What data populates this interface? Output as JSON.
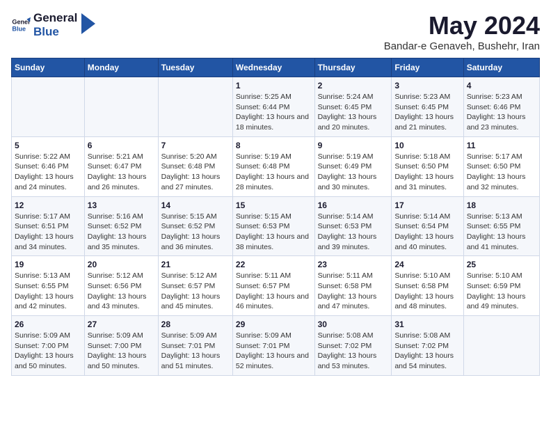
{
  "logo": {
    "text_general": "General",
    "text_blue": "Blue"
  },
  "title": "May 2024",
  "subtitle": "Bandar-e Genaveh, Bushehr, Iran",
  "days_of_week": [
    "Sunday",
    "Monday",
    "Tuesday",
    "Wednesday",
    "Thursday",
    "Friday",
    "Saturday"
  ],
  "weeks": [
    [
      {
        "day": "",
        "info": ""
      },
      {
        "day": "",
        "info": ""
      },
      {
        "day": "",
        "info": ""
      },
      {
        "day": "1",
        "sunrise": "5:25 AM",
        "sunset": "6:44 PM",
        "daylight": "13 hours and 18 minutes."
      },
      {
        "day": "2",
        "sunrise": "5:24 AM",
        "sunset": "6:45 PM",
        "daylight": "13 hours and 20 minutes."
      },
      {
        "day": "3",
        "sunrise": "5:23 AM",
        "sunset": "6:45 PM",
        "daylight": "13 hours and 21 minutes."
      },
      {
        "day": "4",
        "sunrise": "5:23 AM",
        "sunset": "6:46 PM",
        "daylight": "13 hours and 23 minutes."
      }
    ],
    [
      {
        "day": "5",
        "sunrise": "5:22 AM",
        "sunset": "6:46 PM",
        "daylight": "13 hours and 24 minutes."
      },
      {
        "day": "6",
        "sunrise": "5:21 AM",
        "sunset": "6:47 PM",
        "daylight": "13 hours and 26 minutes."
      },
      {
        "day": "7",
        "sunrise": "5:20 AM",
        "sunset": "6:48 PM",
        "daylight": "13 hours and 27 minutes."
      },
      {
        "day": "8",
        "sunrise": "5:19 AM",
        "sunset": "6:48 PM",
        "daylight": "13 hours and 28 minutes."
      },
      {
        "day": "9",
        "sunrise": "5:19 AM",
        "sunset": "6:49 PM",
        "daylight": "13 hours and 30 minutes."
      },
      {
        "day": "10",
        "sunrise": "5:18 AM",
        "sunset": "6:50 PM",
        "daylight": "13 hours and 31 minutes."
      },
      {
        "day": "11",
        "sunrise": "5:17 AM",
        "sunset": "6:50 PM",
        "daylight": "13 hours and 32 minutes."
      }
    ],
    [
      {
        "day": "12",
        "sunrise": "5:17 AM",
        "sunset": "6:51 PM",
        "daylight": "13 hours and 34 minutes."
      },
      {
        "day": "13",
        "sunrise": "5:16 AM",
        "sunset": "6:52 PM",
        "daylight": "13 hours and 35 minutes."
      },
      {
        "day": "14",
        "sunrise": "5:15 AM",
        "sunset": "6:52 PM",
        "daylight": "13 hours and 36 minutes."
      },
      {
        "day": "15",
        "sunrise": "5:15 AM",
        "sunset": "6:53 PM",
        "daylight": "13 hours and 38 minutes."
      },
      {
        "day": "16",
        "sunrise": "5:14 AM",
        "sunset": "6:53 PM",
        "daylight": "13 hours and 39 minutes."
      },
      {
        "day": "17",
        "sunrise": "5:14 AM",
        "sunset": "6:54 PM",
        "daylight": "13 hours and 40 minutes."
      },
      {
        "day": "18",
        "sunrise": "5:13 AM",
        "sunset": "6:55 PM",
        "daylight": "13 hours and 41 minutes."
      }
    ],
    [
      {
        "day": "19",
        "sunrise": "5:13 AM",
        "sunset": "6:55 PM",
        "daylight": "13 hours and 42 minutes."
      },
      {
        "day": "20",
        "sunrise": "5:12 AM",
        "sunset": "6:56 PM",
        "daylight": "13 hours and 43 minutes."
      },
      {
        "day": "21",
        "sunrise": "5:12 AM",
        "sunset": "6:57 PM",
        "daylight": "13 hours and 45 minutes."
      },
      {
        "day": "22",
        "sunrise": "5:11 AM",
        "sunset": "6:57 PM",
        "daylight": "13 hours and 46 minutes."
      },
      {
        "day": "23",
        "sunrise": "5:11 AM",
        "sunset": "6:58 PM",
        "daylight": "13 hours and 47 minutes."
      },
      {
        "day": "24",
        "sunrise": "5:10 AM",
        "sunset": "6:58 PM",
        "daylight": "13 hours and 48 minutes."
      },
      {
        "day": "25",
        "sunrise": "5:10 AM",
        "sunset": "6:59 PM",
        "daylight": "13 hours and 49 minutes."
      }
    ],
    [
      {
        "day": "26",
        "sunrise": "5:09 AM",
        "sunset": "7:00 PM",
        "daylight": "13 hours and 50 minutes."
      },
      {
        "day": "27",
        "sunrise": "5:09 AM",
        "sunset": "7:00 PM",
        "daylight": "13 hours and 50 minutes."
      },
      {
        "day": "28",
        "sunrise": "5:09 AM",
        "sunset": "7:01 PM",
        "daylight": "13 hours and 51 minutes."
      },
      {
        "day": "29",
        "sunrise": "5:09 AM",
        "sunset": "7:01 PM",
        "daylight": "13 hours and 52 minutes."
      },
      {
        "day": "30",
        "sunrise": "5:08 AM",
        "sunset": "7:02 PM",
        "daylight": "13 hours and 53 minutes."
      },
      {
        "day": "31",
        "sunrise": "5:08 AM",
        "sunset": "7:02 PM",
        "daylight": "13 hours and 54 minutes."
      },
      {
        "day": "",
        "info": ""
      }
    ]
  ],
  "labels": {
    "sunrise": "Sunrise:",
    "sunset": "Sunset:",
    "daylight": "Daylight:"
  }
}
